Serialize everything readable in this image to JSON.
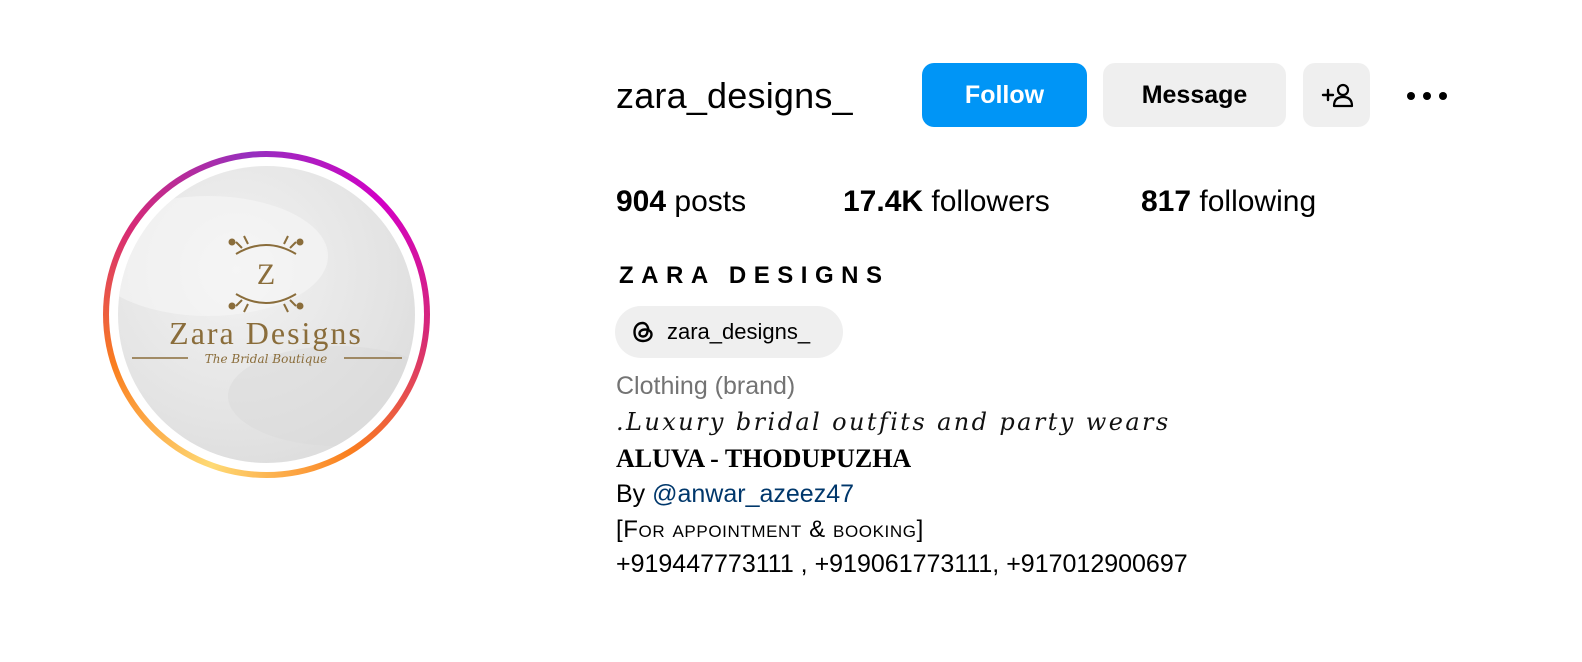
{
  "profile": {
    "username": "zara_designs_",
    "display_name": "ZARA DESIGNS",
    "avatar_logo": {
      "brand": "Zara Designs",
      "tagline": "The Bridal Boutique",
      "monogram": "Z"
    }
  },
  "actions": {
    "follow_label": "Follow",
    "message_label": "Message",
    "suggest_icon": "add-person-icon",
    "more_icon": "more-options-icon"
  },
  "stats": {
    "posts_count": "904",
    "posts_label": " posts",
    "followers_count": "17.4K",
    "followers_label": " followers",
    "following_count": "817",
    "following_label": " following"
  },
  "bio": {
    "threads_handle": "zara_designs_",
    "threads_icon": "threads-icon",
    "category": "Clothing (brand)",
    "tagline": ".Luxury bridal outfits and party wears",
    "location": "ALUVA - THODUPUZHA",
    "by_prefix": "By ",
    "by_mention": "@anwar_azeez47",
    "appointment": "[For appointment & booking]",
    "phones": "+919447773111 , +919061773111, +917012900697"
  },
  "colors": {
    "follow_bg": "#0095f6",
    "button_bg": "#efefef",
    "category_gray": "#737373",
    "mention_blue": "#00376b",
    "logo_gold": "#8a6d3b"
  }
}
